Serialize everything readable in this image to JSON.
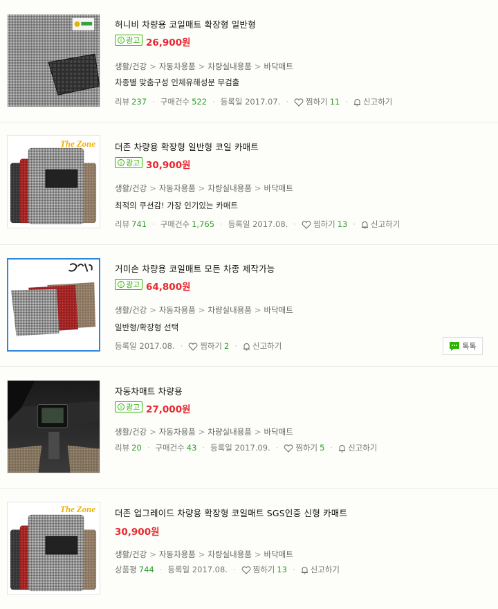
{
  "colors": {
    "price": "#e8282f",
    "ad_green": "#2db400",
    "count_green": "#2d9e2d",
    "selected_border": "#2f86dd"
  },
  "items": [
    {
      "title": "허니비 차량용 코일매트 확장형 일반형",
      "ad": "광고",
      "price": "26,900원",
      "category": [
        "생활/건강",
        "자동차용품",
        "차량실내용품",
        "바닥매트"
      ],
      "description": "차종별 맞춤구성 인체유해성분 무검출",
      "review_label": "리뷰",
      "review_count": "237",
      "purchase_label": "구매건수",
      "purchase_count": "522",
      "date": "등록일 2017.07.",
      "wish_label": "찜하기",
      "wish_count": "11",
      "report_label": "신고하기"
    },
    {
      "title": "더존 차량용 확장형 일반형 코일 카매트",
      "ad": "광고",
      "price": "30,900원",
      "category": [
        "생활/건강",
        "자동차용품",
        "차량실내용품",
        "바닥매트"
      ],
      "description": "최적의 쿠션감! 가장 인기있는 카매트",
      "review_label": "리뷰",
      "review_count": "741",
      "purchase_label": "구매건수",
      "purchase_count": "1,765",
      "date": "등록일 2017.08.",
      "wish_label": "찜하기",
      "wish_count": "13",
      "report_label": "신고하기",
      "thumb_text": "The Zone"
    },
    {
      "title": "거미손 차량용 코일매트 모든 차종 제작가능",
      "ad": "광고",
      "price": "64,800원",
      "category": [
        "생활/건강",
        "자동차용품",
        "차량실내용품",
        "바닥매트"
      ],
      "description": "일반형/확장형 선택",
      "date": "등록일 2017.08.",
      "wish_label": "찜하기",
      "wish_count": "2",
      "report_label": "신고하기",
      "talk_label": "톡톡"
    },
    {
      "title": "자동차매트 차량용",
      "ad": "광고",
      "price": "27,000원",
      "category": [
        "생활/건강",
        "자동차용품",
        "차량실내용품",
        "바닥매트"
      ],
      "review_label": "리뷰",
      "review_count": "20",
      "purchase_label": "구매건수",
      "purchase_count": "43",
      "date": "등록일 2017.09.",
      "wish_label": "찜하기",
      "wish_count": "5",
      "report_label": "신고하기"
    },
    {
      "title": "더존 업그레이드 차량용 확장형 코일매트 SGS인증 신형 카매트",
      "price": "30,900원",
      "category": [
        "생활/건강",
        "자동차용품",
        "차량실내용품",
        "바닥매트"
      ],
      "rating_label": "상품평",
      "rating_count": "744",
      "date": "등록일 2017.08.",
      "wish_label": "찜하기",
      "wish_count": "13",
      "report_label": "신고하기",
      "thumb_text": "The Zone"
    }
  ]
}
